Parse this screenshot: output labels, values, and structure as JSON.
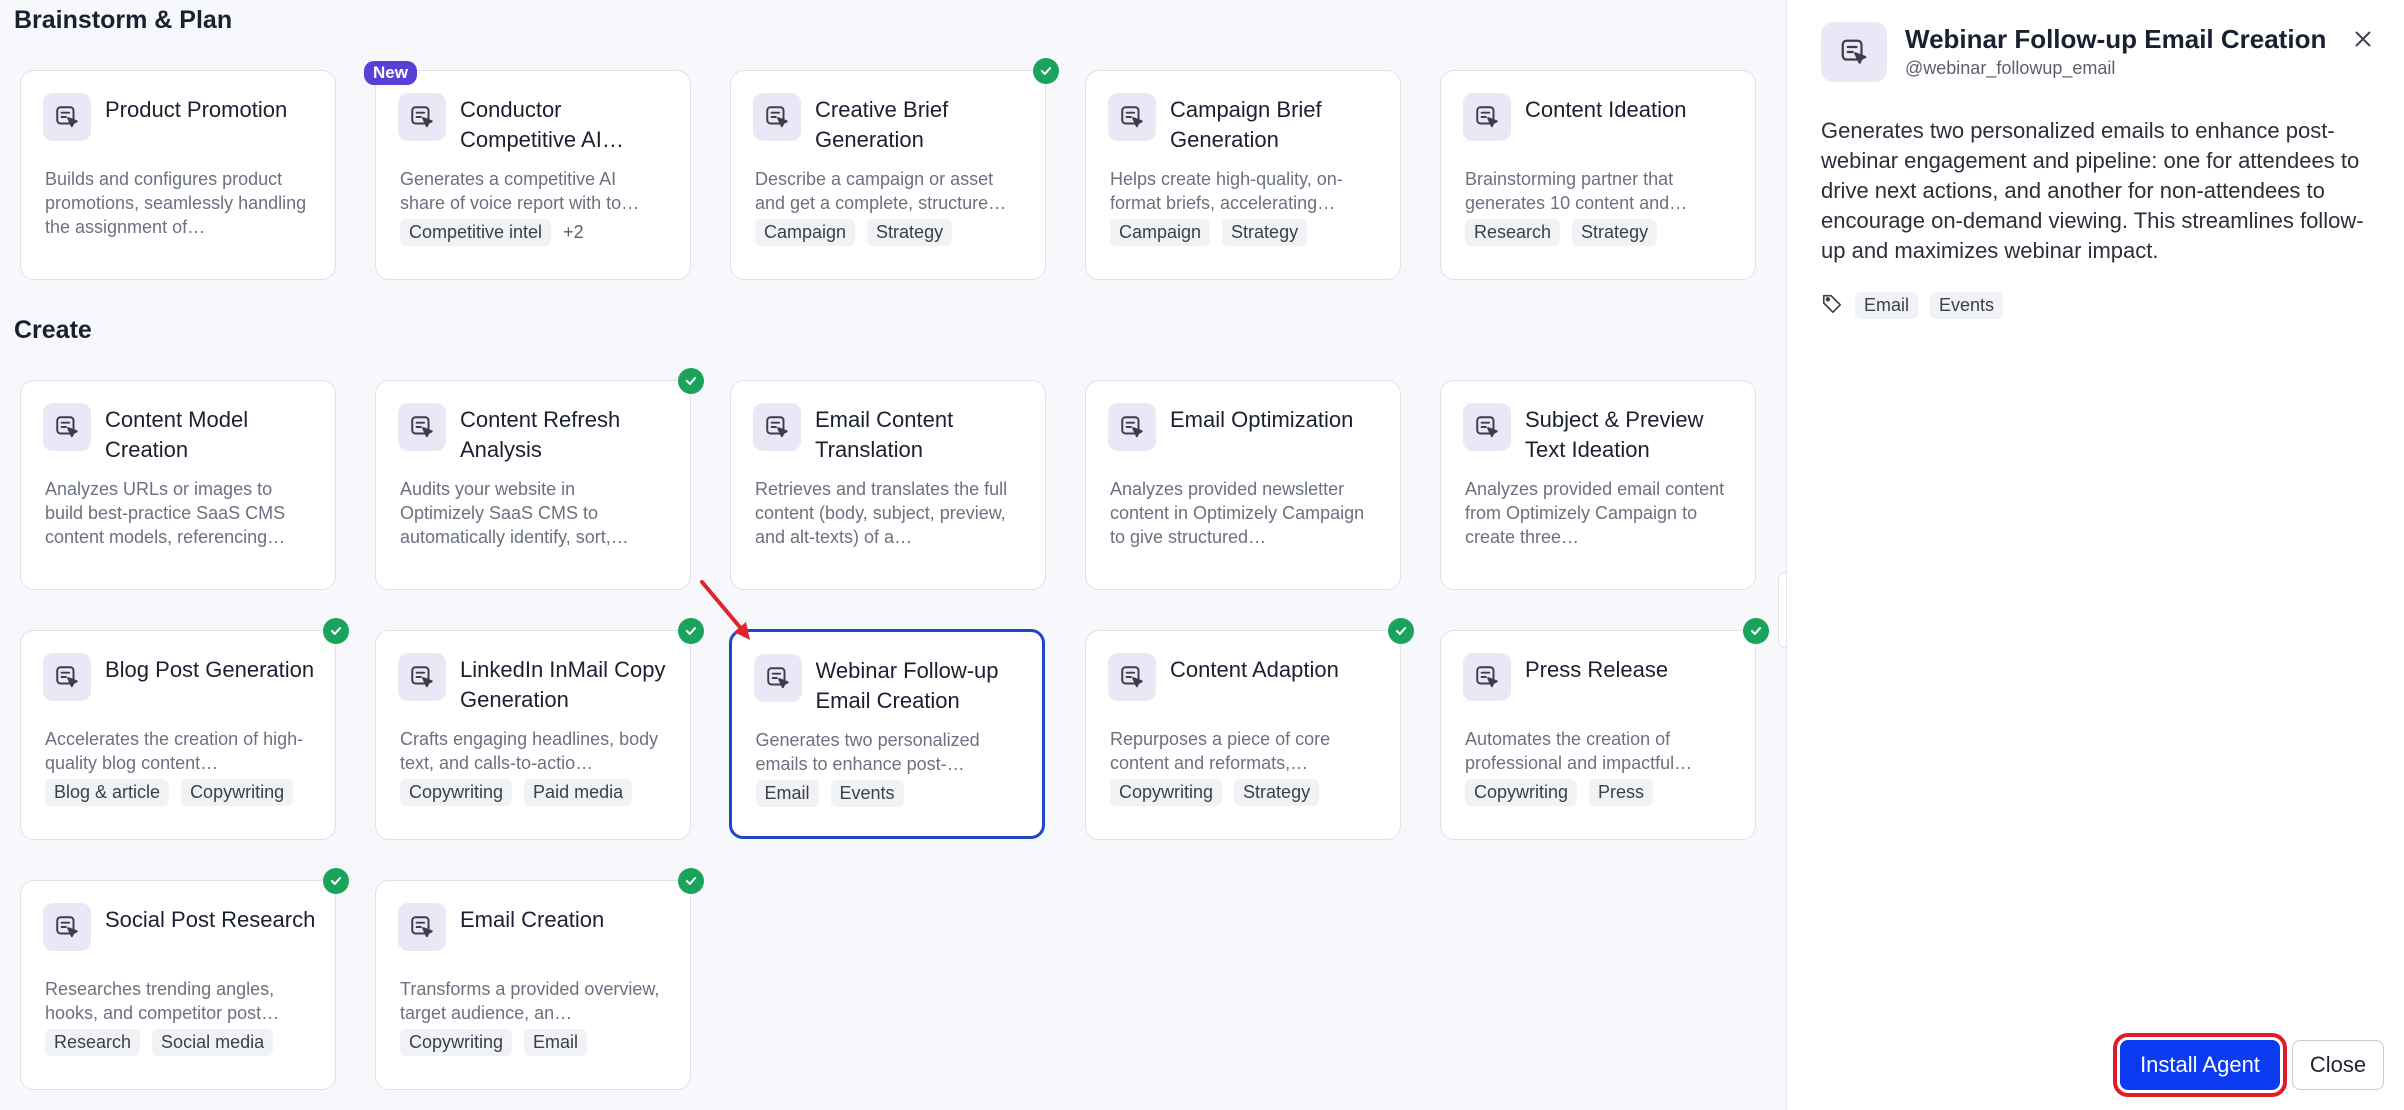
{
  "sections": {
    "brainstorm": "Brainstorm & Plan",
    "create": "Create"
  },
  "cards": [
    {
      "title": "Product Promotion",
      "desc": "Builds and configures product promotions, seamlessly handling the assignment of…",
      "tags": [],
      "more": "",
      "installed": false,
      "new": false
    },
    {
      "title": "Conductor Competitive AI…",
      "desc": "Generates a competitive AI share of voice report with to…",
      "tags": [
        "Competitive intel"
      ],
      "more": "+2",
      "installed": false,
      "new": true,
      "new_label": "New"
    },
    {
      "title": "Creative Brief Generation",
      "desc": "Describe a campaign or asset and get a complete, structure…",
      "tags": [
        "Campaign",
        "Strategy"
      ],
      "more": "",
      "installed": true,
      "new": false
    },
    {
      "title": "Campaign Brief Generation",
      "desc": "Helps create high-quality, on-format briefs, accelerating…",
      "tags": [
        "Campaign",
        "Strategy"
      ],
      "more": "",
      "installed": false,
      "new": false
    },
    {
      "title": "Content Ideation",
      "desc": "Brainstorming partner that generates 10 content and…",
      "tags": [
        "Research",
        "Strategy"
      ],
      "more": "",
      "installed": false,
      "new": false
    },
    {
      "title": "Content Model Creation",
      "desc": "Analyzes URLs or images to build best-practice SaaS CMS content models, referencing…",
      "tags": [],
      "more": "",
      "installed": false,
      "new": false
    },
    {
      "title": "Content Refresh Analysis",
      "desc": "Audits your website in Optimizely SaaS CMS to automatically identify, sort,…",
      "tags": [],
      "more": "",
      "installed": true,
      "new": false
    },
    {
      "title": "Email Content Translation",
      "desc": "Retrieves and translates the full content (body, subject, preview, and alt-texts) of a…",
      "tags": [],
      "more": "",
      "installed": false,
      "new": false
    },
    {
      "title": "Email Optimization",
      "desc": "Analyzes provided newsletter content in Optimizely Campaign to give structured…",
      "tags": [],
      "more": "",
      "installed": false,
      "new": false
    },
    {
      "title": "Subject & Preview Text Ideation",
      "desc": "Analyzes provided email content from Optimizely Campaign to create three…",
      "tags": [],
      "more": "",
      "installed": false,
      "new": false
    },
    {
      "title": "Blog Post Generation",
      "desc": "Accelerates the creation of high-quality blog content…",
      "tags": [
        "Blog & article",
        "Copywriting"
      ],
      "more": "",
      "installed": true,
      "new": false
    },
    {
      "title": "LinkedIn InMail Copy Generation",
      "desc": "Crafts engaging headlines, body text, and calls-to-actio…",
      "tags": [
        "Copywriting",
        "Paid media"
      ],
      "more": "",
      "installed": true,
      "new": false
    },
    {
      "title": "Webinar Follow-up Email Creation",
      "desc": "Generates two personalized emails to enhance post-…",
      "tags": [
        "Email",
        "Events"
      ],
      "more": "",
      "installed": false,
      "new": false,
      "selected": true
    },
    {
      "title": "Content Adaption",
      "desc": "Repurposes a piece of core content and reformats,…",
      "tags": [
        "Copywriting",
        "Strategy"
      ],
      "more": "",
      "installed": true,
      "new": false
    },
    {
      "title": "Press Release",
      "desc": "Automates the creation of professional and impactful…",
      "tags": [
        "Copywriting",
        "Press"
      ],
      "more": "",
      "installed": true,
      "new": false
    },
    {
      "title": "Social Post Research",
      "desc": "Researches trending angles, hooks, and competitor post…",
      "tags": [
        "Research",
        "Social media"
      ],
      "more": "",
      "installed": true,
      "new": false
    },
    {
      "title": "Email Creation",
      "desc": "Transforms a provided overview, target audience, an…",
      "tags": [
        "Copywriting",
        "Email"
      ],
      "more": "",
      "installed": true,
      "new": false
    }
  ],
  "panel": {
    "title": "Webinar Follow-up Email Creation",
    "handle": "@webinar_followup_email",
    "description": "Generates two personalized emails to enhance post-webinar engagement and pipeline: one for attendees to drive next actions, and another for non-attendees to encourage on-demand viewing. This streamlines follow-up and maximizes webinar impact.",
    "tags": [
      "Email",
      "Events"
    ],
    "install_label": "Install Agent",
    "close_label": "Close"
  },
  "colors": {
    "accent": "#0a3bf0",
    "selected_border": "#1f48c8",
    "installed_check": "#19a35b",
    "new_badge": "#5a3fd6",
    "highlight": "#e21b2a"
  }
}
